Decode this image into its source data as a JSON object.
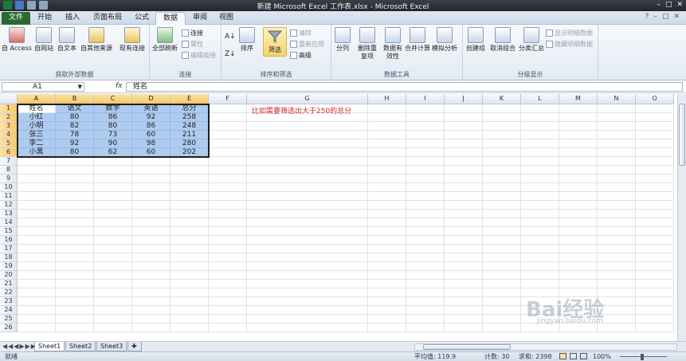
{
  "window": {
    "title": "新建 Microsoft Excel 工作表.xlsx - Microsoft Excel"
  },
  "tabs": [
    {
      "label": "文件"
    },
    {
      "label": "开始"
    },
    {
      "label": "插入"
    },
    {
      "label": "页面布局"
    },
    {
      "label": "公式"
    },
    {
      "label": "数据"
    },
    {
      "label": "审阅"
    },
    {
      "label": "视图"
    }
  ],
  "ribbon": {
    "external": {
      "label": "获取外部数据",
      "access": "自 Access",
      "web": "自网站",
      "text": "自文本",
      "other": "自其他来源",
      "existing": "现有连接"
    },
    "connections": {
      "label": "连接",
      "refresh": "全部刷新",
      "conn": "连接",
      "props": "属性",
      "edit": "编辑链接"
    },
    "sortfilter": {
      "label": "排序和筛选",
      "sort": "排序",
      "filter": "筛选",
      "clear": "清除",
      "reapply": "重新应用",
      "advanced": "高级"
    },
    "datatools": {
      "label": "数据工具",
      "split": "分列",
      "dedupe": "删除重复项",
      "validation": "数据有效性",
      "consolidate": "合并计算",
      "whatif": "模拟分析"
    },
    "outline": {
      "label": "分级显示",
      "group": "创建组",
      "ungroup": "取消组合",
      "subtotal": "分类汇总",
      "show": "显示明细数据",
      "hide": "隐藏明细数据"
    }
  },
  "formula": {
    "namebox": "A1",
    "fx": "fx",
    "content": "姓名"
  },
  "columns": [
    "A",
    "B",
    "C",
    "D",
    "E",
    "F",
    "G",
    "H",
    "I",
    "J",
    "K",
    "L",
    "M",
    "N",
    "O"
  ],
  "rows": [
    "1",
    "2",
    "3",
    "4",
    "5",
    "6",
    "7",
    "8",
    "9",
    "10",
    "11",
    "12",
    "13",
    "14",
    "15",
    "16",
    "17",
    "18",
    "19",
    "20",
    "21",
    "22",
    "23",
    "24",
    "25",
    "26"
  ],
  "table": {
    "header": [
      "姓名",
      "语文",
      "数学",
      "英语",
      "总分"
    ],
    "data": [
      [
        "小红",
        "80",
        "86",
        "92",
        "258"
      ],
      [
        "小明",
        "82",
        "80",
        "86",
        "248"
      ],
      [
        "张三",
        "78",
        "73",
        "60",
        "211"
      ],
      [
        "李二",
        "92",
        "90",
        "98",
        "280"
      ],
      [
        "小黑",
        "80",
        "62",
        "60",
        "202"
      ]
    ]
  },
  "note": "比如需要筛选出大于250的总分",
  "sheets": [
    "Sheet1",
    "Sheet2",
    "Sheet3"
  ],
  "status": {
    "ready": "就绪",
    "average": "平均值: 119.9",
    "count": "计数: 30",
    "sum": "求和: 2398",
    "zoom": "100%"
  },
  "watermark": {
    "brand": "Bai经验",
    "url": "jingyan.baidu.com"
  }
}
